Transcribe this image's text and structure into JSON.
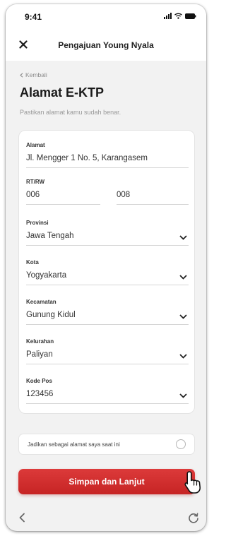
{
  "status_bar": {
    "time": "9:41"
  },
  "header": {
    "title": "Pengajuan Young Nyala"
  },
  "back_link": {
    "label": "Kembali"
  },
  "page": {
    "title": "Alamat E-KTP",
    "subtitle": "Pastikan alamat kamu sudah benar."
  },
  "form": {
    "address": {
      "label": "Alamat",
      "value": "Jl. Mengger 1 No. 5, Karangasem"
    },
    "rt_rw": {
      "label": "RT/RW",
      "rt": "006",
      "rw": "008"
    },
    "province": {
      "label": "Provinsi",
      "value": "Jawa Tengah"
    },
    "city": {
      "label": "Kota",
      "value": "Yogyakarta"
    },
    "district": {
      "label": "Kecamatan",
      "value": "Gunung Kidul"
    },
    "village": {
      "label": "Kelurahan",
      "value": "Paliyan"
    },
    "postal_code": {
      "label": "Kode Pos",
      "value": "123456"
    }
  },
  "current_address_option": {
    "label": "Jadikan sebagai alamat saya saat ini",
    "checked": false
  },
  "submit_button": {
    "label": "Simpan dan Lanjut"
  },
  "colors": {
    "primary": "#d32f2f",
    "background": "#f2f2f2",
    "card": "#ffffff"
  },
  "icons": {
    "close": "close-icon",
    "dropdown": "chevron-down-icon",
    "nav_back": "chevron-left-icon",
    "nav_refresh": "refresh-icon",
    "cursor": "hand-pointer-icon"
  }
}
